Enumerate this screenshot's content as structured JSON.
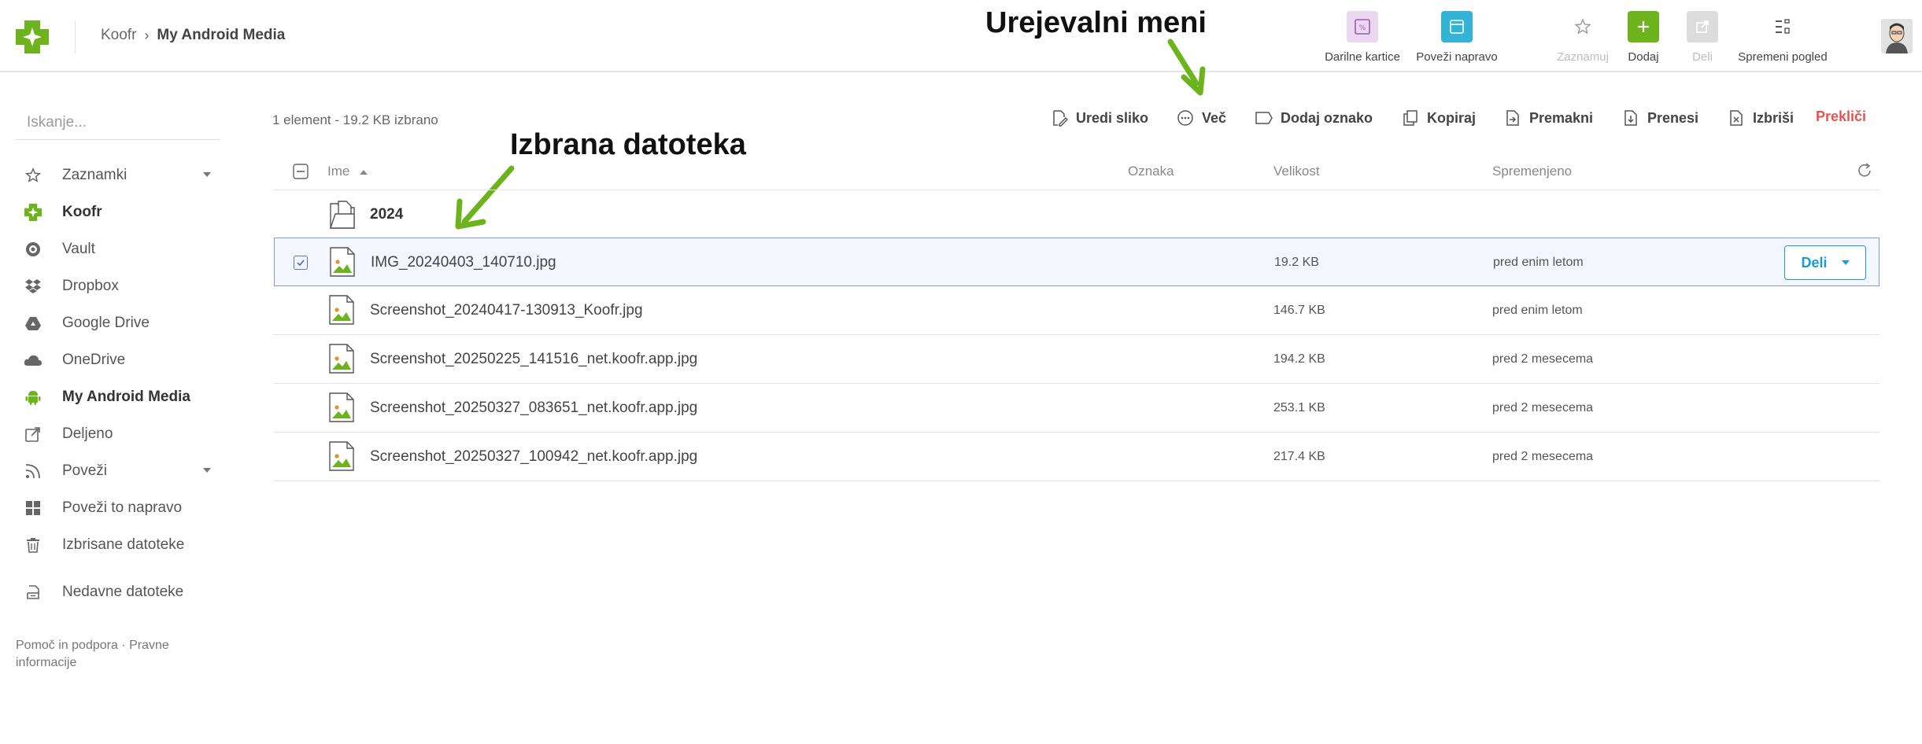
{
  "header": {
    "breadcrumb": [
      "Koofr",
      "My Android Media"
    ],
    "buttons": [
      {
        "label": "Darilne kartice",
        "icon": "gift-card-icon",
        "color": "#e9d3ef"
      },
      {
        "label": "Poveži napravo",
        "icon": "device-link-icon",
        "color": "#33b3d6"
      },
      {
        "label": "Zaznamuj",
        "icon": "star-icon",
        "disabled": true
      },
      {
        "label": "Dodaj",
        "icon": "plus-icon",
        "color": "#6db31d"
      },
      {
        "label": "Deli",
        "icon": "share-icon",
        "disabled": true,
        "color": "#d9d9d9"
      },
      {
        "label": "Spremeni pogled",
        "icon": "view-toggle-icon"
      }
    ]
  },
  "annotations": {
    "edit_menu": "Urejevalni meni",
    "selected_file": "Izbrana datoteka",
    "arrow_color": "#6db31d"
  },
  "sidebar": {
    "search_placeholder": "Iskanje...",
    "items": [
      {
        "label": "Zaznamki",
        "icon": "star-icon",
        "caret": true
      },
      {
        "label": "Koofr",
        "icon": "koofr-logo-icon",
        "bold": true
      },
      {
        "label": "Vault",
        "icon": "vault-icon"
      },
      {
        "label": "Dropbox",
        "icon": "dropbox-icon"
      },
      {
        "label": "Google Drive",
        "icon": "google-drive-icon"
      },
      {
        "label": "OneDrive",
        "icon": "onedrive-icon"
      },
      {
        "label": "My Android Media",
        "icon": "android-icon",
        "bold": true
      },
      {
        "label": "Deljeno",
        "icon": "shared-icon"
      },
      {
        "label": "Poveži",
        "icon": "rss-icon",
        "caret": true
      },
      {
        "label": "Poveži to napravo",
        "icon": "windows-icon"
      },
      {
        "label": "Izbrisane datoteke",
        "icon": "trash-icon"
      },
      {
        "label": "Nedavne datoteke",
        "icon": "recent-files-icon"
      }
    ],
    "footer": "Pomoč in podpora · Pravne informacije"
  },
  "toolbar": {
    "selection_info": "1 element - 19.2 KB izbrano",
    "actions": [
      {
        "label": "Uredi sliko",
        "icon": "edit-image-icon"
      },
      {
        "label": "Več",
        "icon": "more-icon"
      },
      {
        "label": "Dodaj oznako",
        "icon": "tag-icon"
      },
      {
        "label": "Kopiraj",
        "icon": "copy-icon"
      },
      {
        "label": "Premakni",
        "icon": "move-icon"
      },
      {
        "label": "Prenesi",
        "icon": "download-icon"
      },
      {
        "label": "Izbriši",
        "icon": "delete-icon"
      },
      {
        "label": "Prekliči",
        "icon": ""
      }
    ],
    "cancel_color": "#e55353"
  },
  "table": {
    "columns": {
      "name": "Ime",
      "tag": "Oznaka",
      "size": "Velikost",
      "modified": "Spremenjeno"
    },
    "rows": [
      {
        "name": "2024",
        "type": "folder",
        "size": "",
        "modified": ""
      },
      {
        "name": "IMG_20240403_140710.jpg",
        "type": "image",
        "size": "19.2 KB",
        "modified": "pred enim letom",
        "selected": true,
        "share_label": "Deli"
      },
      {
        "name": "Screenshot_20240417-130913_Koofr.jpg",
        "type": "image",
        "size": "146.7 KB",
        "modified": "pred enim letom"
      },
      {
        "name": "Screenshot_20250225_141516_net.koofr.app.jpg",
        "type": "image",
        "size": "194.2 KB",
        "modified": "pred 2 mesecema"
      },
      {
        "name": "Screenshot_20250327_083651_net.koofr.app.jpg",
        "type": "image",
        "size": "253.1 KB",
        "modified": "pred 2 mesecema"
      },
      {
        "name": "Screenshot_20250327_100942_net.koofr.app.jpg",
        "type": "image",
        "size": "217.4 KB",
        "modified": "pred 2 mesecema"
      }
    ]
  },
  "colors": {
    "brand_green": "#6db31d",
    "selection_border": "#7e9ad0",
    "share_blue": "#1a9bd7"
  }
}
